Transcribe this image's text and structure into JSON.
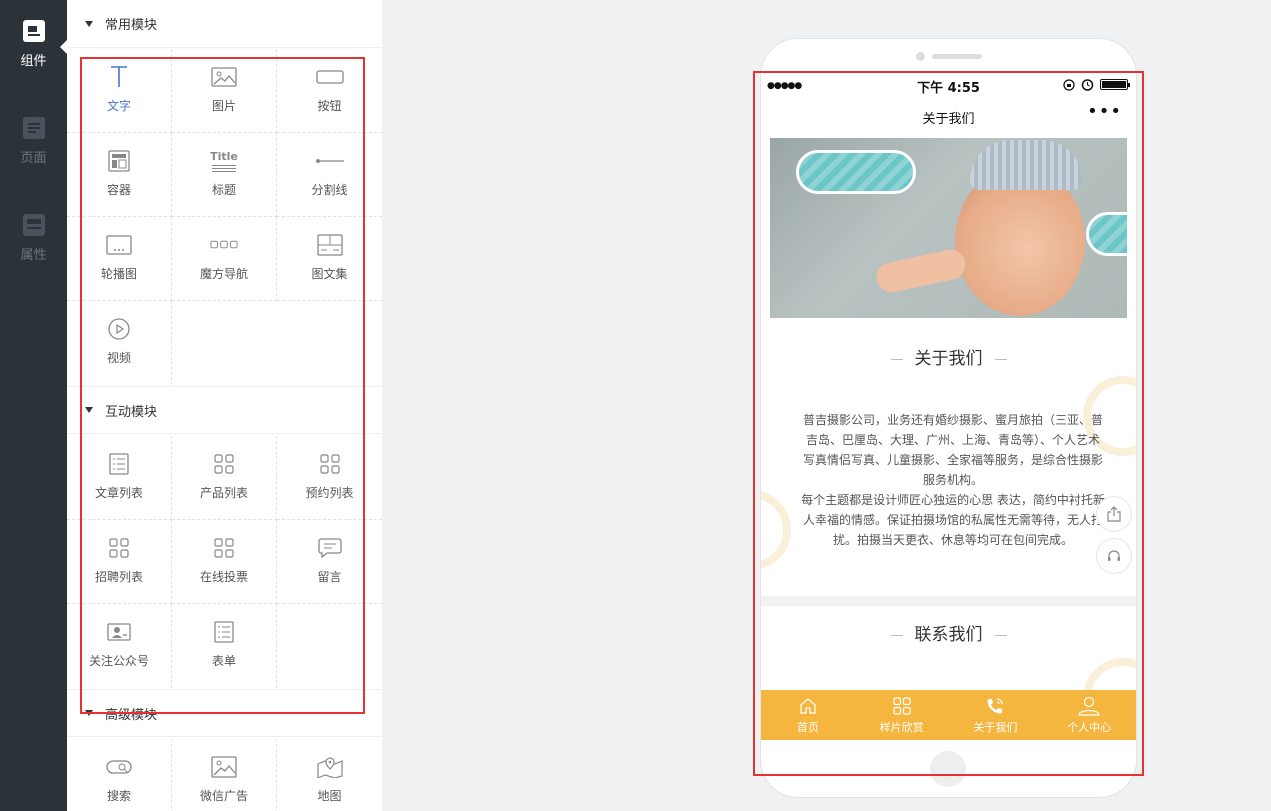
{
  "nav": {
    "items": [
      {
        "label": "组件",
        "icon": "component-icon",
        "active": true
      },
      {
        "label": "页面",
        "icon": "page-icon",
        "active": false
      },
      {
        "label": "属性",
        "icon": "property-icon",
        "active": false
      }
    ]
  },
  "panel": {
    "sections": [
      {
        "title": "常用模块",
        "items": [
          {
            "label": "文字",
            "icon": "text-icon"
          },
          {
            "label": "图片",
            "icon": "image-icon"
          },
          {
            "label": "按钮",
            "icon": "button-icon"
          },
          {
            "label": "容器",
            "icon": "container-icon"
          },
          {
            "label": "标题",
            "icon": "title-icon",
            "icon_text": "Title"
          },
          {
            "label": "分割线",
            "icon": "divider-icon"
          },
          {
            "label": "轮播图",
            "icon": "carousel-icon"
          },
          {
            "label": "魔方导航",
            "icon": "cube-nav-icon"
          },
          {
            "label": "图文集",
            "icon": "gallery-icon"
          },
          {
            "label": "视频",
            "icon": "video-icon"
          }
        ]
      },
      {
        "title": "互动模块",
        "items": [
          {
            "label": "文章列表",
            "icon": "article-list-icon"
          },
          {
            "label": "产品列表",
            "icon": "product-list-icon"
          },
          {
            "label": "预约列表",
            "icon": "booking-list-icon"
          },
          {
            "label": "招聘列表",
            "icon": "job-list-icon"
          },
          {
            "label": "在线投票",
            "icon": "vote-icon"
          },
          {
            "label": "留言",
            "icon": "message-icon"
          },
          {
            "label": "关注公众号",
            "icon": "follow-account-icon"
          },
          {
            "label": "表单",
            "icon": "form-icon"
          }
        ]
      },
      {
        "title": "高级模块",
        "items": [
          {
            "label": "搜索",
            "icon": "search-icon"
          },
          {
            "label": "微信广告",
            "icon": "wechat-ad-icon"
          },
          {
            "label": "地图",
            "icon": "map-icon"
          }
        ]
      }
    ]
  },
  "phone": {
    "status": {
      "signal": "●●●●●",
      "time": "下午 4:55"
    },
    "navbar": {
      "title": "关于我们",
      "more": "•••"
    },
    "about": {
      "title": "关于我们",
      "paragraph1": "普吉摄影公司，业务还有婚纱摄影、蜜月旅拍（三亚、普吉岛、巴厘岛、大理、广州、上海、青岛等）、个人艺术写真情侣写真、儿童摄影、全家福等服务，是综合性摄影服务机构。",
      "paragraph2": "每个主题都是设计师匠心独运的心思 表达，简约中衬托新人幸福的情感。保证拍摄场馆的私属性无需等待，无人打扰。拍摄当天更衣、休息等均可在包间完成。"
    },
    "contact": {
      "title": "联系我们"
    },
    "tabs": [
      {
        "label": "首页",
        "icon": "home-icon"
      },
      {
        "label": "样片欣赏",
        "icon": "grid-icon"
      },
      {
        "label": "关于我们",
        "icon": "phone-call-icon"
      },
      {
        "label": "个人中心",
        "icon": "user-icon"
      }
    ]
  },
  "colors": {
    "nav_bg": "#2b3238",
    "highlight_red": "#e53333",
    "tabbar": "#f4b63f",
    "accent_blue": "#4b73d6"
  }
}
